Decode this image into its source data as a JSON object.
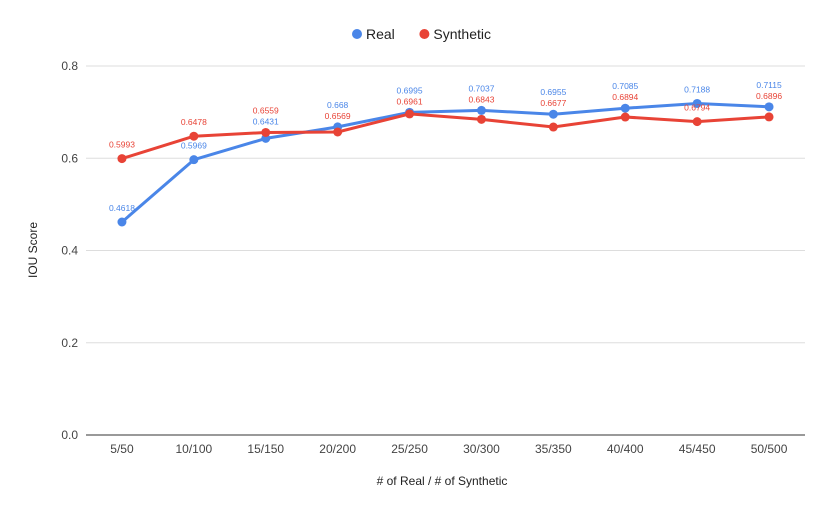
{
  "chart_data": {
    "type": "line",
    "title": "",
    "xlabel": "# of Real / # of Synthetic",
    "ylabel": "IOU Score",
    "ylim": [
      0,
      0.8
    ],
    "yticks": [
      "0.0",
      "0.2",
      "0.4",
      "0.6",
      "0.8"
    ],
    "yticks_values": [
      0,
      0.2,
      0.4,
      0.6,
      0.8
    ],
    "grid": true,
    "legend": "top-center",
    "categories": [
      "5/50",
      "10/100",
      "15/150",
      "20/200",
      "25/250",
      "30/300",
      "35/350",
      "40/400",
      "45/450",
      "50/500"
    ],
    "series": [
      {
        "name": "Real",
        "color": "#4a86e8",
        "values": [
          0.4618,
          0.5969,
          0.6431,
          0.668,
          0.6995,
          0.7037,
          0.6955,
          0.7085,
          0.7188,
          0.7115
        ],
        "labels": [
          "0.4618",
          "0.5969",
          "0.6431",
          "0.668",
          "0.6995",
          "0.7037",
          "0.6955",
          "0.7085",
          "0.7188",
          "0.7115"
        ]
      },
      {
        "name": "Synthetic",
        "color": "#e84336",
        "values": [
          0.5993,
          0.6478,
          0.6559,
          0.6569,
          0.6961,
          0.6843,
          0.6677,
          0.6894,
          0.6794,
          0.6896
        ],
        "labels": [
          "0.5993",
          "0.6478",
          "0.6559",
          "0.6569",
          "0.6961",
          "0.6843",
          "0.6677",
          "0.6894",
          "0.6794",
          "0.6896"
        ]
      }
    ]
  }
}
